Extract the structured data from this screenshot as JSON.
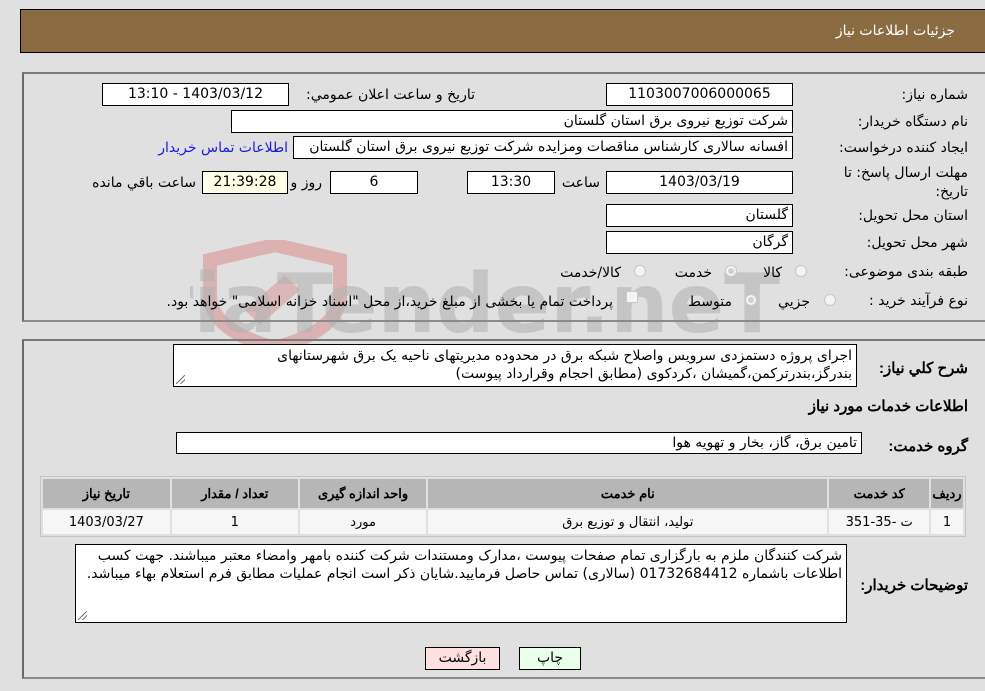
{
  "header": {
    "title": "جزئیات اطلاعات نیاز"
  },
  "form": {
    "need_number": {
      "label": "شماره نیاز:",
      "value": "1103007006000065"
    },
    "announce_datetime": {
      "label": "تاریخ و ساعت اعلان عمومي:",
      "value": "1403/03/12 - 13:10"
    },
    "buyer_org": {
      "label": "نام دستگاه خریدار:",
      "value": "شرکت توزیع نیروی برق استان گلستان"
    },
    "creator": {
      "label": "ایجاد کننده درخواست:",
      "value": "افسانه سالاری کارشناس مناقصات ومزایده شرکت توزیع نیروی برق استان گلستان",
      "contact_link": "اطلاعات تماس خریدار"
    },
    "deadline": {
      "label": "مهلت ارسال پاسخ: تا تاریخ:",
      "date": "1403/03/19",
      "time_label": "ساعت",
      "time": "13:30",
      "days": "6",
      "days_label": "روز و",
      "remaining": "21:39:28",
      "remaining_label": "ساعت باقي مانده"
    },
    "province": {
      "label": "استان محل تحویل:",
      "value": "گلستان"
    },
    "city": {
      "label": "شهر محل تحویل:",
      "value": "گرگان"
    },
    "category": {
      "label": "طبقه بندی موضوعی:",
      "options": [
        "کالا",
        "خدمت",
        "کالا/خدمت"
      ],
      "selected": "خدمت"
    },
    "purchase_type": {
      "label": "نوع فرآیند خرید :",
      "options": [
        "جزیي",
        "متوسط"
      ],
      "selected": "متوسط",
      "treasury_checkbox_label": "پرداخت تمام یا بخشی از مبلغ خرید،از محل \"اسناد خزانه اسلامی\" خواهد بود.",
      "treasury_checked": false
    }
  },
  "details": {
    "summary": {
      "label": "شرح کلي نیاز:",
      "value": "اجرای پروژه دستمزدی سرویس واصلاح شبکه برق در محدوده  مدیریتهای ناحیه یک  برق شهرستانهای بندرگز،بندرترکمن،گمیشان ،کردکوی (مطابق احجام وقرارداد پیوست)"
    },
    "services_heading": "اطلاعات خدمات مورد نیاز",
    "service_group": {
      "label": "گروه خدمت:",
      "value": "تامین برق، گاز، بخار و تهویه هوا"
    },
    "table": {
      "headers": [
        "ردیف",
        "کد خدمت",
        "نام خدمت",
        "واحد اندازه گیری",
        "تعداد / مقدار",
        "تاریخ نیاز"
      ],
      "rows": [
        [
          "1",
          "ت -35-351",
          "تولید، انتقال و توزیع برق",
          "مورد",
          "1",
          "1403/03/27"
        ]
      ]
    },
    "buyer_notes": {
      "label": "توضیحات خریدار:",
      "value": "شرکت کنندگان ملزم به بارگزاری تمام صفحات پیوست ،مدارک ومستندات شرکت کننده بامهر وامضاء معتبر میباشند. جهت کسب اطلاعات باشماره 01732684412 (سالاری) تماس حاصل فرمایید.شایان ذکر است انجام عملیات  مطابق فرم استعلام بهاء میباشد."
    }
  },
  "buttons": {
    "print": "چاپ",
    "back": "بازگشت"
  },
  "watermark": {
    "text": "AriaTender.neT"
  },
  "colors": {
    "header_bg": "#8b6c42",
    "print_bg": "#eaffea",
    "back_bg": "#ffe0e0",
    "link": "#1a1adc"
  }
}
